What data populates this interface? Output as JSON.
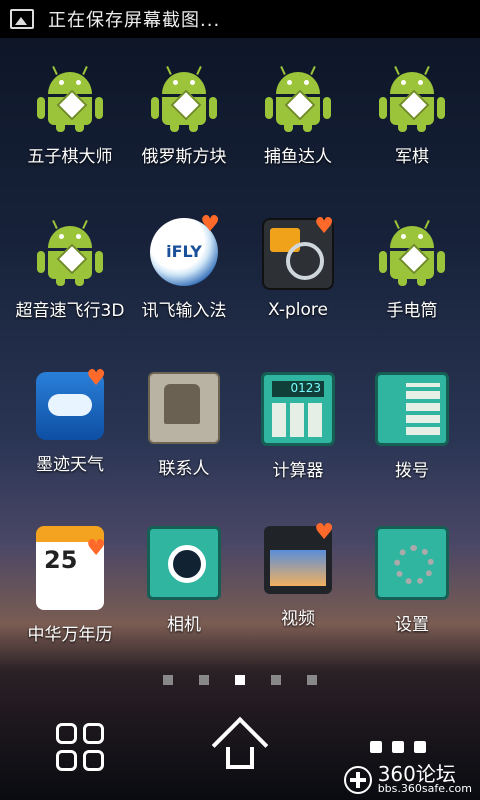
{
  "status_bar": {
    "text": "正在保存屏幕截图..."
  },
  "apps": [
    {
      "label": "五子棋大师",
      "icon": "android-icon"
    },
    {
      "label": "俄罗斯方块",
      "icon": "android-icon"
    },
    {
      "label": "捕鱼达人",
      "icon": "android-icon"
    },
    {
      "label": "军棋",
      "icon": "android-icon"
    },
    {
      "label": "超音速飞行3D",
      "icon": "android-icon"
    },
    {
      "label": "讯飞输入法",
      "icon": "ifly-icon",
      "icon_text": "iFLY"
    },
    {
      "label": "X-plore",
      "icon": "xplore-icon"
    },
    {
      "label": "手电筒",
      "icon": "android-icon"
    },
    {
      "label": "墨迹天气",
      "icon": "weather-icon"
    },
    {
      "label": "联系人",
      "icon": "contacts-icon"
    },
    {
      "label": "计算器",
      "icon": "calculator-icon"
    },
    {
      "label": "拨号",
      "icon": "phone-dialer-icon"
    },
    {
      "label": "中华万年历",
      "icon": "calendar-icon",
      "icon_text": "25"
    },
    {
      "label": "相机",
      "icon": "camera-icon"
    },
    {
      "label": "视频",
      "icon": "video-icon"
    },
    {
      "label": "设置",
      "icon": "settings-icon"
    }
  ],
  "page_indicator": {
    "count": 5,
    "active": 3
  },
  "dock": {
    "apps_button": "app-drawer-icon",
    "home_button": "home-icon",
    "more_button": "more-icon"
  },
  "watermark": {
    "title": "360论坛",
    "url": "bbs.360safe.com"
  }
}
